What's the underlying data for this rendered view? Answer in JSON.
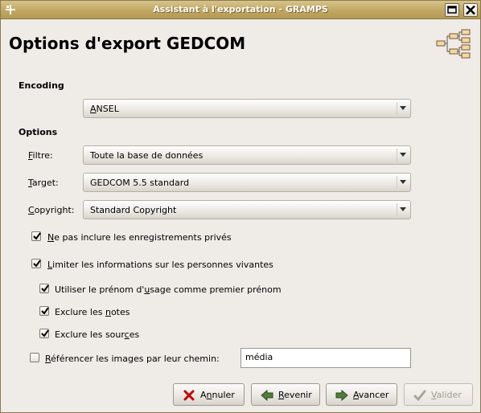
{
  "window": {
    "title": "Assistant à l'exportation - GRAMPS"
  },
  "header": {
    "title": "Options d'export GEDCOM"
  },
  "encoding": {
    "section_label": "Encoding",
    "value_mn": "A",
    "value_rest": "NSEL"
  },
  "options": {
    "section_label": "Options",
    "filter": {
      "label_mn": "F",
      "label_rest": "iltre:",
      "value": "Toute la base de données"
    },
    "target": {
      "label_mn": "T",
      "label_rest": "arget:",
      "value": "GEDCOM 5.5 standard"
    },
    "copyright": {
      "label_mn": "C",
      "label_rest": "opyright:",
      "value": "Standard Copyright"
    }
  },
  "checks": {
    "private": {
      "checked": true,
      "mn": "N",
      "rest": "e pas inclure les enregistrements privés"
    },
    "living": {
      "checked": true,
      "mn": "L",
      "rest": "imiter les informations sur les personnes vivantes"
    },
    "nickname": {
      "checked": true,
      "pre": "Utiliser le prénom d'",
      "mn": "u",
      "post": "sage comme premier prénom"
    },
    "notes": {
      "checked": true,
      "pre": "Exclure les ",
      "mn": "n",
      "post": "otes"
    },
    "sources": {
      "checked": true,
      "pre": "Exclure les sour",
      "mn": "c",
      "post": "es"
    },
    "images": {
      "checked": false,
      "mn": "R",
      "rest": "éférencer les images par leur chemin:"
    }
  },
  "image_path": {
    "value": "média"
  },
  "buttons": {
    "cancel": {
      "mn": "n",
      "pre": "A",
      "post": "nuler",
      "icon": "cancel-x-icon"
    },
    "back": {
      "mn": "R",
      "pre": "",
      "post": "evenir",
      "icon": "arrow-left-icon"
    },
    "forward": {
      "mn": "A",
      "pre": "",
      "post": "vancer",
      "icon": "arrow-right-icon"
    },
    "apply": {
      "mn": "V",
      "pre": "",
      "post": "alider",
      "icon": "check-icon",
      "disabled": true
    }
  },
  "colors": {
    "titlebar": "#c1a763",
    "accent_check": "#000000",
    "window_bg": "#efebe7"
  }
}
